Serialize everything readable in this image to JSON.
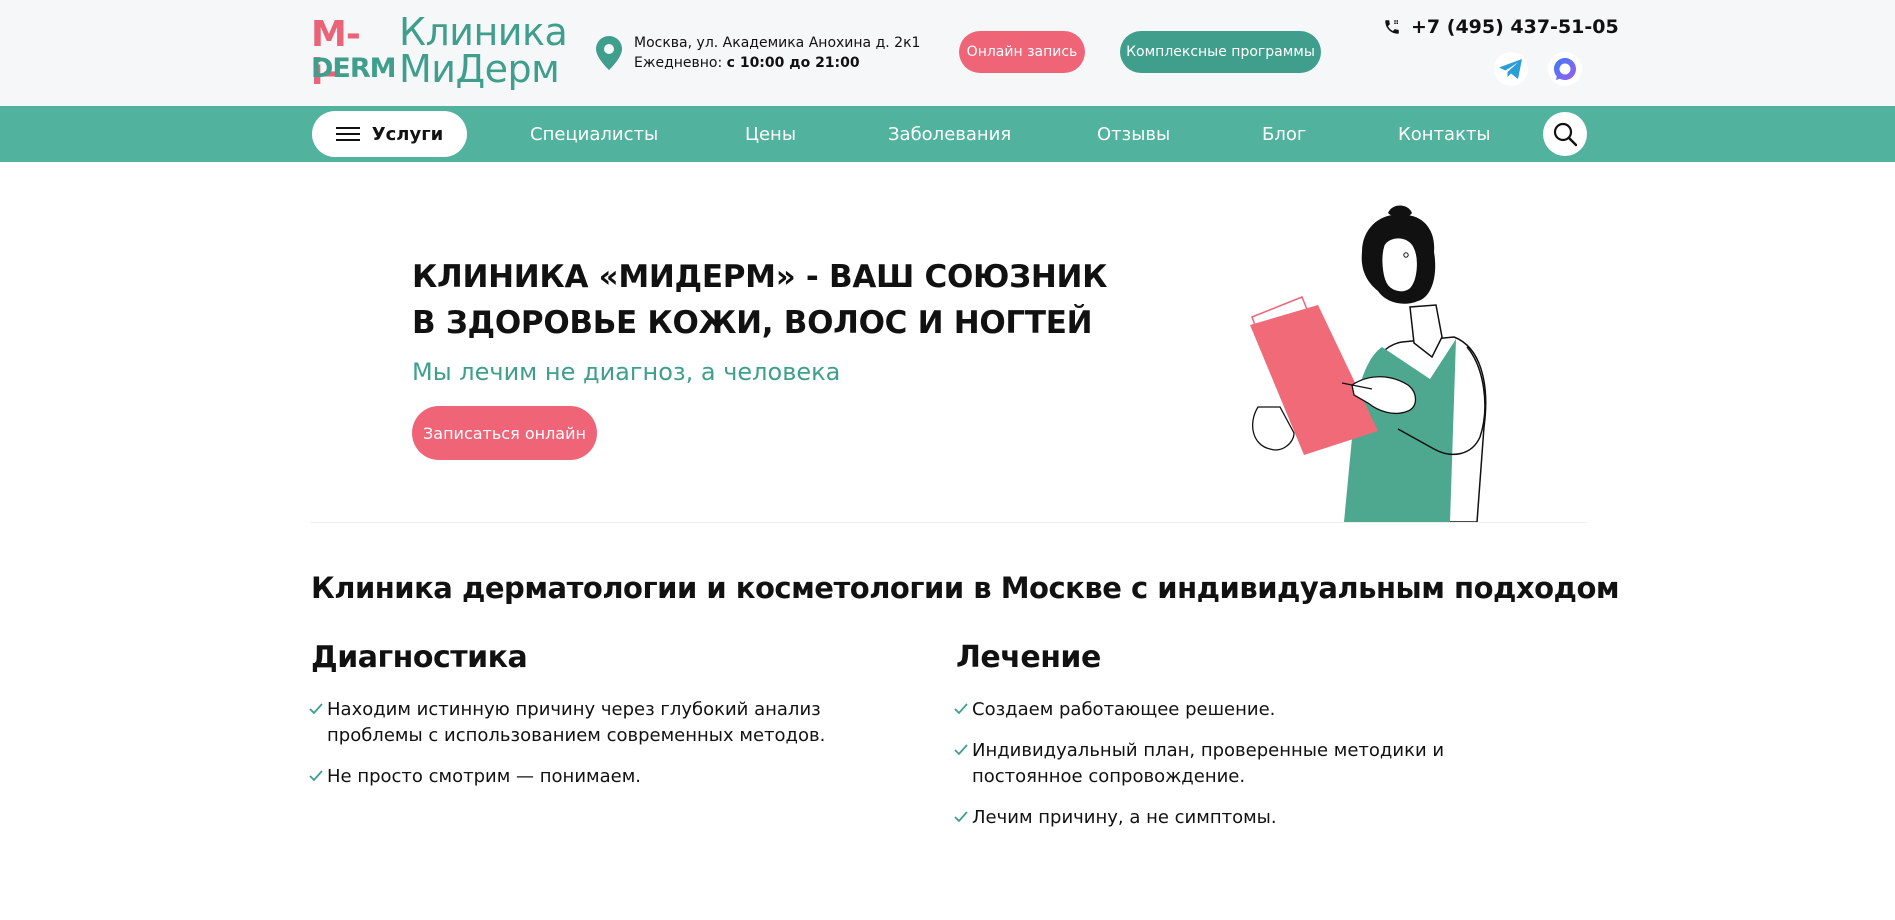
{
  "header": {
    "logo": {
      "mark_top": "M-i-",
      "mark_bottom": "DERM",
      "line1": "Клиника",
      "line2": "МиДерм"
    },
    "address": {
      "street": "Москва, ул. Академика Анохина д. 2к1",
      "hours_prefix": "Ежедневно: ",
      "hours": "с 10:00 до 21:00"
    },
    "online_button": "Онлайн запись",
    "programs_button": "Комплексные программы",
    "phone": "+7 (495) 437-51-05"
  },
  "nav": {
    "services": "Услуги",
    "items": [
      "Специалисты",
      "Цены",
      "Заболевания",
      "Отзывы",
      "Блог",
      "Контакты"
    ]
  },
  "hero": {
    "title_line1": "КЛИНИКА «МИДЕРМ» - ВАШ СОЮЗНИК",
    "title_line2": "В ЗДОРОВЬЕ КОЖИ, ВОЛОС И НОГТЕЙ",
    "subtitle": "Мы лечим не диагноз, а человека",
    "cta": "Записаться онлайн"
  },
  "info": {
    "title": "Клиника дерматологии и косметологии в Москве с индивидуальным подходом",
    "diagnostics": {
      "title": "Диагностика",
      "items": [
        "Находим истинную причину через глубокий анализ проблемы с использованием современных методов.",
        "Не просто смотрим — понимаем."
      ]
    },
    "treatment": {
      "title": "Лечение",
      "items": [
        "Создаем работающее решение.",
        "Индивидуальный план, проверенные методики и постоянное сопровождение.",
        "Лечим причину, а не симптомы."
      ]
    }
  },
  "colors": {
    "accent_green": "#51b29e",
    "brand_green": "#3f9f8c",
    "accent_pink": "#ef6577"
  },
  "icons": [
    "location-pin-icon",
    "phone-icon",
    "telegram-icon",
    "max-messenger-icon",
    "menu-icon",
    "search-icon",
    "check-icon"
  ]
}
